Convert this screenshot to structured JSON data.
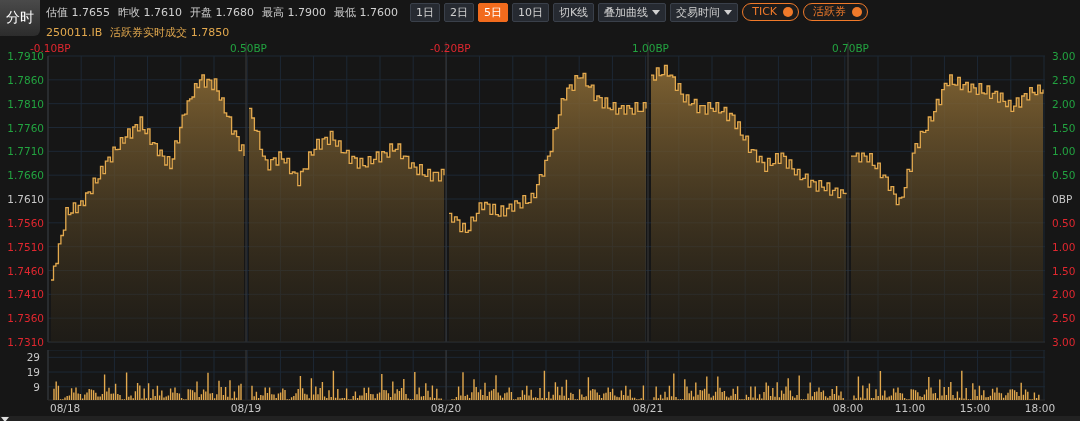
{
  "mode_tab": {
    "label": "分时"
  },
  "stats": [
    {
      "label": "估值",
      "value": "1.7655"
    },
    {
      "label": "昨收",
      "value": "1.7610"
    },
    {
      "label": "开盘",
      "value": "1.7680"
    },
    {
      "label": "最高",
      "value": "1.7900"
    },
    {
      "label": "最低",
      "value": "1.7600"
    }
  ],
  "period_buttons": [
    {
      "label": "1日",
      "selected": false
    },
    {
      "label": "2日",
      "selected": false
    },
    {
      "label": "5日",
      "selected": true
    },
    {
      "label": "10日",
      "selected": false
    },
    {
      "label": "切K线",
      "selected": false
    }
  ],
  "dropdowns": [
    {
      "label": "叠加曲线"
    },
    {
      "label": "交易时间"
    }
  ],
  "toggles": [
    {
      "label": "TICK",
      "on": true
    },
    {
      "label": "活跃券",
      "on": true
    }
  ],
  "subtitle": {
    "code": "250011.IB",
    "text": "活跃券实时成交 1.7850"
  },
  "day_changes": [
    {
      "text": "-0.10BP",
      "color": "#e0272f"
    },
    {
      "text": "0.50BP",
      "color": "#22a340"
    },
    {
      "text": "-0.20BP",
      "color": "#e0272f"
    },
    {
      "text": "1.00BP",
      "color": "#22a340"
    },
    {
      "text": "0.70BP",
      "color": "#22a340"
    }
  ],
  "price_axis": [
    {
      "text": "1.7910",
      "color": "#22a340"
    },
    {
      "text": "1.7860",
      "color": "#22a340"
    },
    {
      "text": "1.7810",
      "color": "#22a340"
    },
    {
      "text": "1.7760",
      "color": "#22a340"
    },
    {
      "text": "1.7710",
      "color": "#22a340"
    },
    {
      "text": "1.7660",
      "color": "#22a340"
    },
    {
      "text": "1.7610",
      "color": "#c8c8c8"
    },
    {
      "text": "1.7560",
      "color": "#e0272f"
    },
    {
      "text": "1.7510",
      "color": "#e0272f"
    },
    {
      "text": "1.7460",
      "color": "#e0272f"
    },
    {
      "text": "1.7410",
      "color": "#e0272f"
    },
    {
      "text": "1.7360",
      "color": "#e0272f"
    },
    {
      "text": "1.7310",
      "color": "#e0272f"
    }
  ],
  "bp_axis": [
    {
      "text": "3.00",
      "color": "#22a340"
    },
    {
      "text": "2.50",
      "color": "#22a340"
    },
    {
      "text": "2.00",
      "color": "#22a340"
    },
    {
      "text": "1.50",
      "color": "#22a340"
    },
    {
      "text": "1.00",
      "color": "#22a340"
    },
    {
      "text": "0.50",
      "color": "#22a340"
    },
    {
      "text": "0BP",
      "color": "#c8c8c8"
    },
    {
      "text": "0.50",
      "color": "#e0272f"
    },
    {
      "text": "1.00",
      "color": "#e0272f"
    },
    {
      "text": "1.50",
      "color": "#e0272f"
    },
    {
      "text": "2.00",
      "color": "#e0272f"
    },
    {
      "text": "2.50",
      "color": "#e0272f"
    },
    {
      "text": "3.00",
      "color": "#e0272f"
    }
  ],
  "volume_axis": [
    "29",
    "19",
    "9"
  ],
  "time_axis": [
    "08/18",
    "08/19",
    "08/20",
    "08/21",
    "08:00",
    "11:00",
    "15:00",
    "18:00"
  ]
}
